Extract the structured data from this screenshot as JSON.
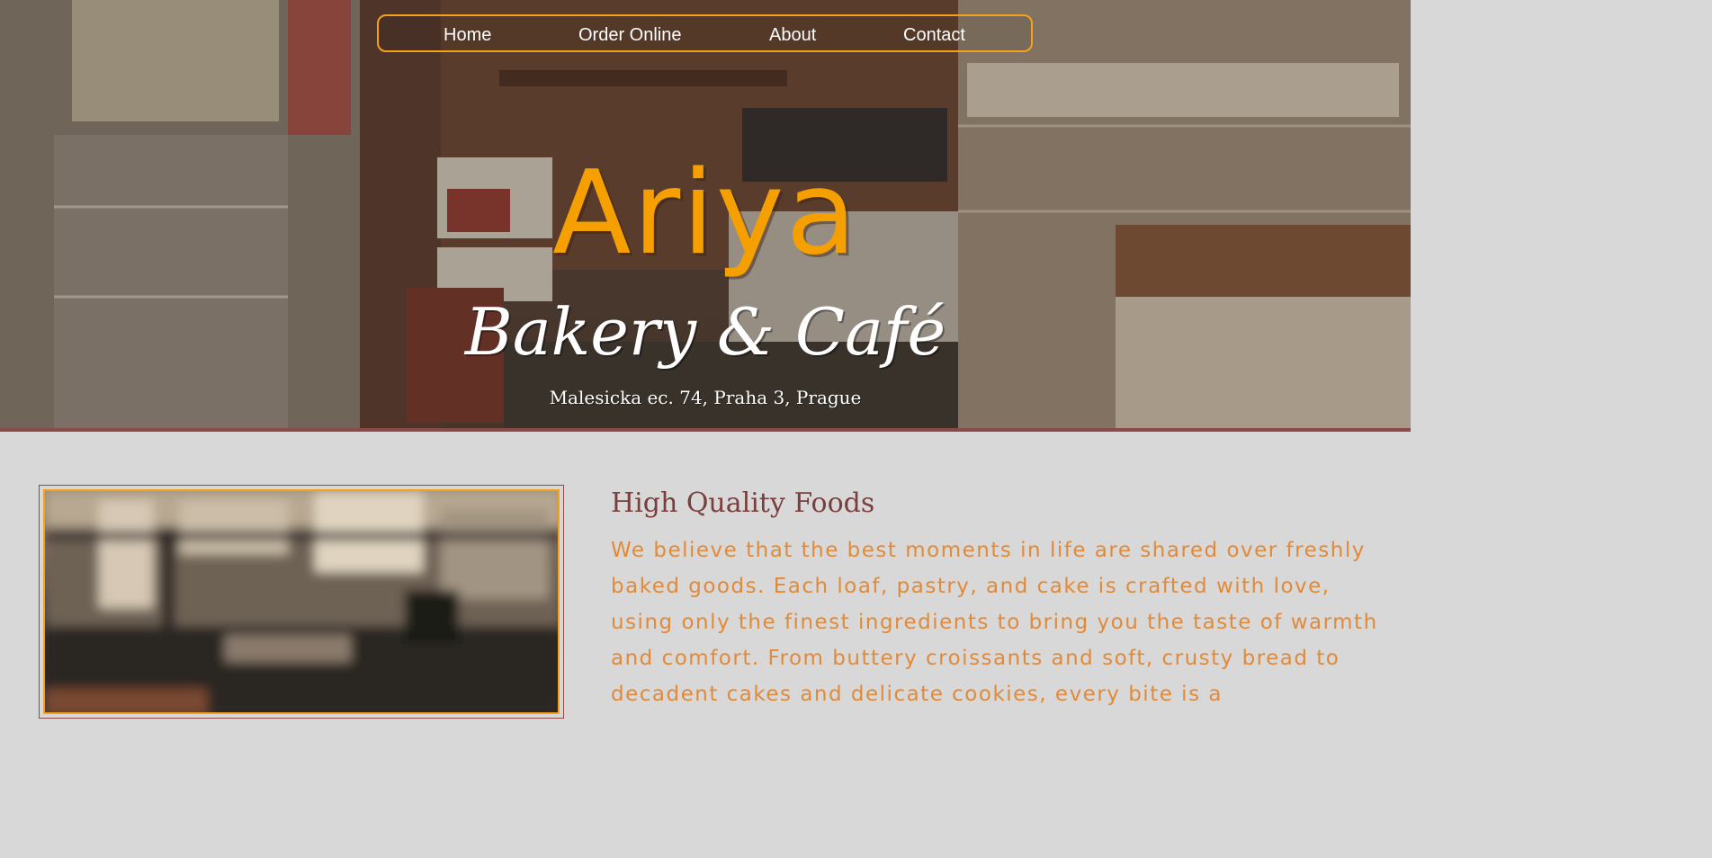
{
  "nav": {
    "items": [
      {
        "label": "Home"
      },
      {
        "label": "Order Online"
      },
      {
        "label": "About"
      },
      {
        "label": "Contact"
      }
    ]
  },
  "hero": {
    "brand": "Ariya",
    "subtitle": "Bakery & Café",
    "address": "Malesicka ec. 74, Praha 3, Prague"
  },
  "about": {
    "title": "High Quality Foods",
    "body": "We believe that the best moments in life are shared over freshly baked goods. Each loaf, pastry, and cake is crafted with love, using only the finest ingredients to bring you the taste of warmth and comfort. From buttery croissants and soft, crusty bread to decadent cakes and delicate cookies, every bite is a"
  },
  "colors": {
    "accent": "#f5a000",
    "maroon": "#7a3e3e",
    "body_text": "#e08a3a",
    "page_bg": "#d8d8d8"
  }
}
